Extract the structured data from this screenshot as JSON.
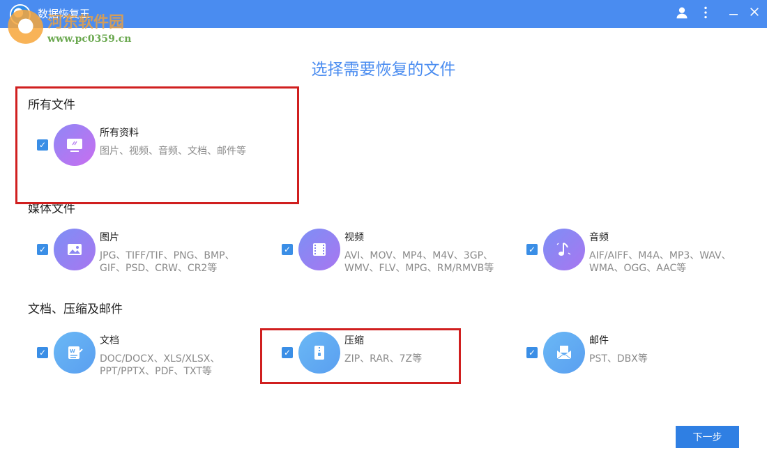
{
  "window": {
    "title": "数据恢复王"
  },
  "watermark": {
    "text": "河东软件园",
    "url": "www.pc0359.cn"
  },
  "page": {
    "title": "选择需要恢复的文件"
  },
  "sections": [
    {
      "title": "所有文件"
    },
    {
      "title": "媒体文件"
    },
    {
      "title": "文档、压缩及邮件"
    }
  ],
  "items": {
    "all": {
      "name": "所有资料",
      "desc": "图片、视频、音频、文档、邮件等",
      "checked": true,
      "icon": "monitor-icon"
    },
    "images": {
      "name": "图片",
      "desc": "JPG、TIFF/TIF、PNG、BMP、GIF、PSD、CRW、CR2等",
      "checked": true,
      "icon": "image-icon"
    },
    "video": {
      "name": "视频",
      "desc": "AVI、MOV、MP4、M4V、3GP、WMV、FLV、MPG、RM/RMVB等",
      "checked": true,
      "icon": "film-icon"
    },
    "audio": {
      "name": "音频",
      "desc": "AIF/AIFF、M4A、MP3、WAV、WMA、OGG、AAC等",
      "checked": true,
      "icon": "music-icon"
    },
    "docs": {
      "name": "文档",
      "desc": "DOC/DOCX、XLS/XLSX、PPT/PPTX、PDF、TXT等",
      "checked": true,
      "icon": "document-icon"
    },
    "archive": {
      "name": "压缩",
      "desc": "ZIP、RAR、7Z等",
      "checked": true,
      "icon": "zip-icon"
    },
    "email": {
      "name": "邮件",
      "desc": "PST、DBX等",
      "checked": true,
      "icon": "envelope-icon"
    }
  },
  "buttons": {
    "next": "下一步"
  },
  "colors": {
    "accent": "#4a8cf0",
    "button": "#2f7fe3",
    "highlight_box": "#d01f1f"
  }
}
